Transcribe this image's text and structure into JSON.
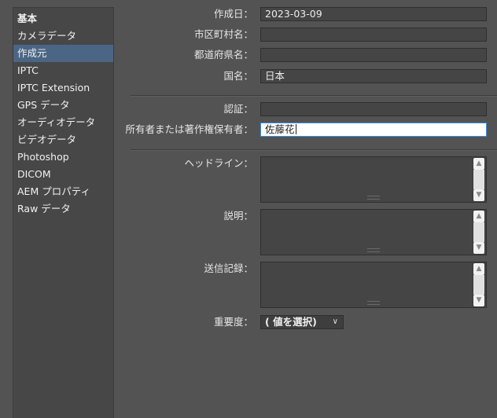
{
  "sidebar": {
    "items": [
      {
        "label": "基本"
      },
      {
        "label": "カメラデータ"
      },
      {
        "label": "作成元"
      },
      {
        "label": "IPTC"
      },
      {
        "label": "IPTC Extension"
      },
      {
        "label": "GPS データ"
      },
      {
        "label": "オーディオデータ"
      },
      {
        "label": "ビデオデータ"
      },
      {
        "label": "Photoshop"
      },
      {
        "label": "DICOM"
      },
      {
        "label": "AEM プロパティ"
      },
      {
        "label": "Raw データ"
      }
    ],
    "selected_index": 2
  },
  "form": {
    "creation_date": {
      "label": "作成日：",
      "value": "2023-03-09"
    },
    "city": {
      "label": "市区町村名：",
      "value": ""
    },
    "prefecture": {
      "label": "都道府県名：",
      "value": ""
    },
    "country": {
      "label": "国名：",
      "value": "日本"
    },
    "credit": {
      "label": "認証：",
      "value": ""
    },
    "owner": {
      "label": "所有者または著作権保有者：",
      "value": "佐藤花"
    },
    "headline": {
      "label": "ヘッドライン：",
      "value": ""
    },
    "description": {
      "label": "説明：",
      "value": ""
    },
    "transmission": {
      "label": "送信記録：",
      "value": ""
    },
    "urgency": {
      "label": "重要度：",
      "value": "( 値を選択)"
    }
  },
  "colors": {
    "background": "#535353",
    "sidebar_bg": "#474747",
    "selected": "#4b6584",
    "focus_border": "#3d8ee0"
  }
}
